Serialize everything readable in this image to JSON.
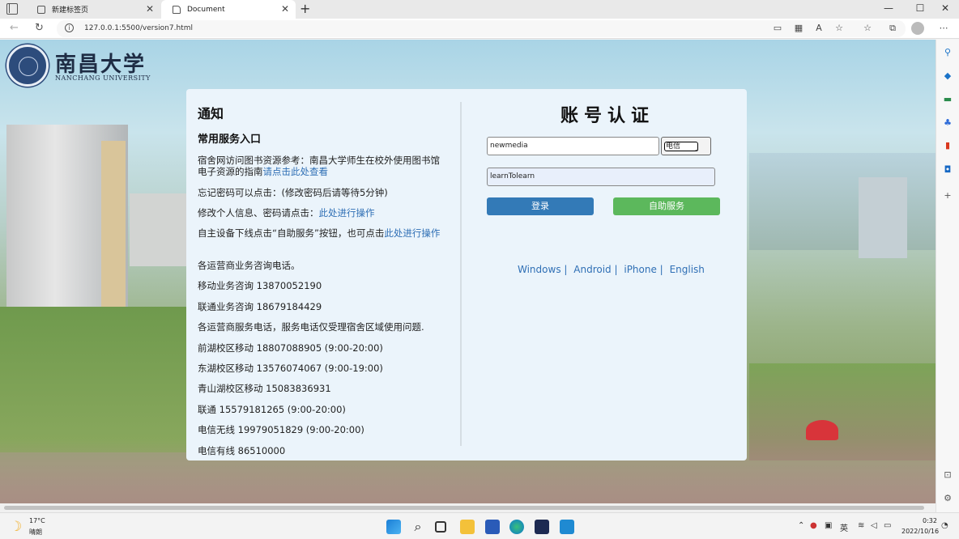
{
  "browser": {
    "tabs": [
      {
        "label": "新建标签页",
        "close": "✕"
      },
      {
        "label": "Document",
        "close": "✕"
      }
    ],
    "new_tab": "+",
    "window_controls": {
      "minimize": "—",
      "maximize": "☐",
      "close": "✕"
    },
    "url": "127.0.0.1:5500/version7.html"
  },
  "logo": {
    "name_cn": "南昌大学",
    "name_en": "NANCHANG UNIVERSITY"
  },
  "notice": {
    "title": "通知",
    "subtitle": "常用服务入口",
    "lines": [
      {
        "text": "宿舍网访问图书资源参考：南昌大学师生在校外使用图书馆电子资源的指南",
        "link": "请点击此处查看"
      },
      {
        "text": "忘记密码可以点击：(修改密码后请等待5分钟)",
        "link": ""
      },
      {
        "text": "修改个人信息、密码请点击：",
        "link": "此处进行操作"
      },
      {
        "text": "自主设备下线点击“自助服务”按钮，也可点击",
        "link": "此处进行操作"
      },
      {
        "text": "各运营商业务咨询电话。",
        "link": ""
      },
      {
        "text": "移动业务咨询 13870052190",
        "link": ""
      },
      {
        "text": "联通业务咨询 18679184429",
        "link": ""
      },
      {
        "text": "各运营商服务电话，服务电话仅受理宿舍区域使用问题.",
        "link": ""
      },
      {
        "text": "前湖校区移动 18807088905 (9:00-20:00)",
        "link": ""
      },
      {
        "text": "东湖校区移动 13576074067 (9:00-19:00)",
        "link": ""
      },
      {
        "text": "青山湖校区移动 15083836931",
        "link": ""
      },
      {
        "text": "联通 15579181265 (9:00-20:00)",
        "link": ""
      },
      {
        "text": "电信无线 19979051829 (9:00-20:00)",
        "link": ""
      },
      {
        "text": "电信有线 86510000",
        "link": ""
      }
    ]
  },
  "login": {
    "title": "账号认证",
    "username_value": "newmedia",
    "isp_selected": "电信",
    "password_value": "learnTolearn",
    "login_button": "登录",
    "self_service_button": "自助服务",
    "platform_links": [
      "Windows |",
      "Android |",
      "iPhone |",
      "English"
    ]
  },
  "taskbar": {
    "temperature": "17°C",
    "weather": "晴朗",
    "ime": "英",
    "time": "0:32",
    "date": "2022/10/16"
  },
  "colors": {
    "login_button": "#337ab7",
    "self_service_button": "#5cb85c",
    "link": "#2f6fb5",
    "panel": "#ebf4fb"
  }
}
